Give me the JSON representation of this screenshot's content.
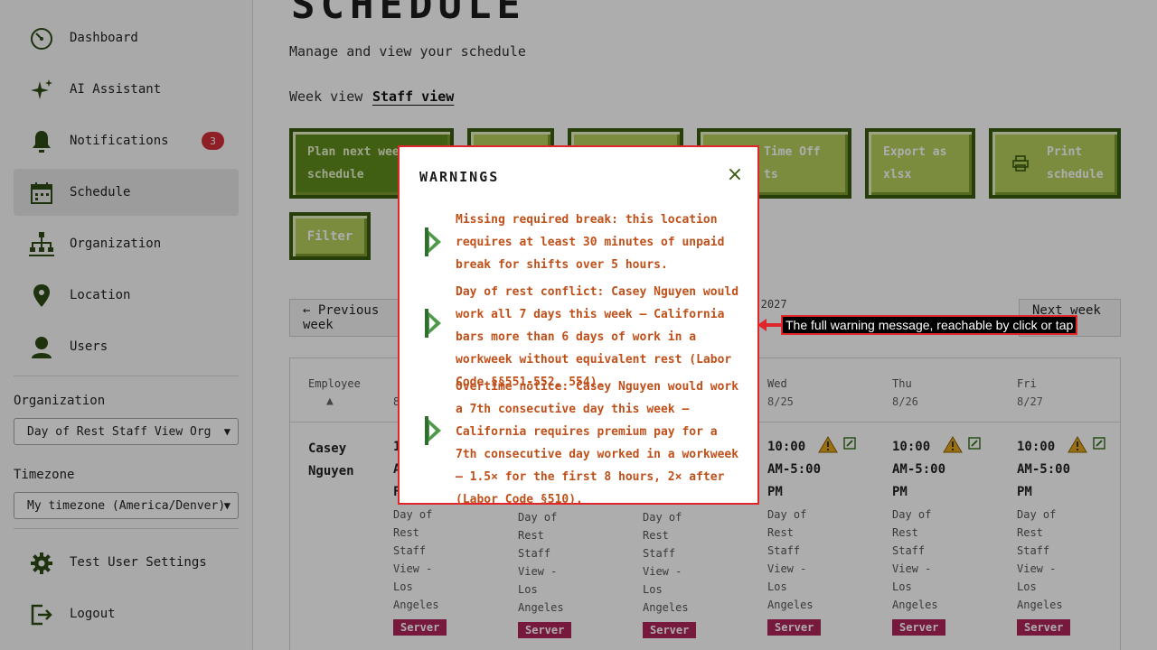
{
  "sidebar": {
    "items": [
      {
        "label": "Dashboard",
        "icon": "dashboard-icon"
      },
      {
        "label": "AI Assistant",
        "icon": "sparkle-icon"
      },
      {
        "label": "Notifications",
        "icon": "bell-icon",
        "badge": "3"
      },
      {
        "label": "Schedule",
        "icon": "calendar-icon",
        "active": true
      },
      {
        "label": "Organization",
        "icon": "org-chart-icon"
      },
      {
        "label": "Location",
        "icon": "map-pin-icon"
      },
      {
        "label": "Users",
        "icon": "user-icon"
      }
    ],
    "organization_label": "Organization",
    "organization_value": "Day of Rest Staff View Org",
    "timezone_label": "Timezone",
    "timezone_value": "My timezone (America/Denver)",
    "settings_label": "Test User Settings",
    "logout_label": "Logout"
  },
  "header": {
    "title": "SCHEDULE",
    "subtitle": "Manage and view your schedule"
  },
  "tabs": [
    {
      "label": "Week view",
      "active": false
    },
    {
      "label": "Staff view",
      "active": true
    }
  ],
  "actions": {
    "plan_line1": "Plan next week",
    "plan_line2": "schedule",
    "time_off_line1": "Time Off",
    "time_off_line2": "ts",
    "export_line1": "Export as",
    "export_line2": "xlsx",
    "print_line1": "Print",
    "print_line2": "schedule",
    "filter": "Filter"
  },
  "week_nav": {
    "previous": "← Previous week",
    "next": "Next week →",
    "date_fragment": "8, 2027"
  },
  "table": {
    "employee_header": "Employee",
    "sort_indicator": "▲",
    "partial_date": "8",
    "days": [
      {
        "day": "Wed",
        "date": "8/25"
      },
      {
        "day": "Thu",
        "date": "8/26"
      },
      {
        "day": "Fri",
        "date": "8/27"
      }
    ],
    "employee_first": "Casey",
    "employee_last": "Nguyen",
    "partial_time_1": "1",
    "partial_time_2": "A",
    "partial_time_3": "F",
    "shift_time_1": "10:00",
    "shift_time_2": "AM-5:00",
    "shift_time_3": "PM",
    "location_lines": [
      "Day of",
      "Rest",
      "Staff",
      "View -",
      "Los",
      "Angeles"
    ],
    "role": "Server"
  },
  "modal": {
    "title": "WARNINGS",
    "close": "×",
    "warnings": [
      "Missing required break: this location requires at least 30 minutes of unpaid break for shifts over 5 hours.",
      "Day of rest conflict: Casey Nguyen would work all 7 days this week – California bars more than 6 days of work in a workweek without equivalent rest (Labor Code §§551-552, 554).",
      "Overtime notice: Casey Nguyen would work a 7th consecutive day this week – California requires premium pay for a 7th consecutive day worked in a workweek – 1.5× for the first 8 hours, 2× after (Labor Code §510)."
    ]
  },
  "callout": {
    "text": "The full warning message, reachable by click or tap"
  },
  "colors": {
    "accent_green": "#5f8c1c",
    "button_green": "#b5cf5c",
    "warning_orange": "#c0501a",
    "badge_red": "#d32f3a",
    "role_magenta": "#b0245a",
    "modal_border": "#e0262a"
  }
}
